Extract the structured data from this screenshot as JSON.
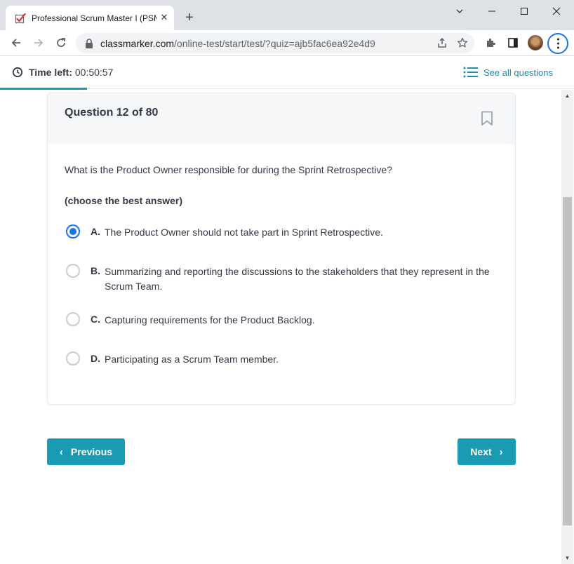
{
  "browser": {
    "tab_title": "Professional Scrum Master I (PSM I)",
    "tab_close": "✕",
    "new_tab": "+",
    "url_host": "classmarker.com",
    "url_path": "/online-test/start/test/?quiz=ajb5fac6ea92e4d9",
    "icons": {
      "favicon": "checkbox-check-icon",
      "back": "arrow-left-icon",
      "forward": "arrow-right-icon",
      "reload": "reload-icon",
      "lock": "lock-icon",
      "share": "share-icon",
      "star": "star-icon",
      "extensions": "puzzle-icon",
      "sidepanel": "sidepanel-icon",
      "menu": "kebab-menu-icon"
    },
    "accent_color": "#1a73e8"
  },
  "header": {
    "time_label": "Time left:",
    "time_value": "00:50:57",
    "see_all": "See all questions",
    "progress_fraction": 0.15,
    "accent_color": "#1a9bb4"
  },
  "question": {
    "number_label": "Question 12 of 80",
    "text": "What is the Product Owner responsible for during the Sprint Retrospective?",
    "instruction": "(choose the best answer)",
    "options": [
      {
        "letter": "A.",
        "text": "The Product Owner should not take part in Sprint Retrospective.",
        "selected": true
      },
      {
        "letter": "B.",
        "text": "Summarizing and reporting the discussions to the stakeholders that they represent in the Scrum Team.",
        "selected": false
      },
      {
        "letter": "C.",
        "text": "Capturing requirements for the Product Backlog.",
        "selected": false
      },
      {
        "letter": "D.",
        "text": "Participating as a Scrum Team member.",
        "selected": false
      }
    ]
  },
  "nav": {
    "previous": "Previous",
    "next": "Next",
    "prev_chevron": "‹",
    "next_chevron": "›"
  }
}
